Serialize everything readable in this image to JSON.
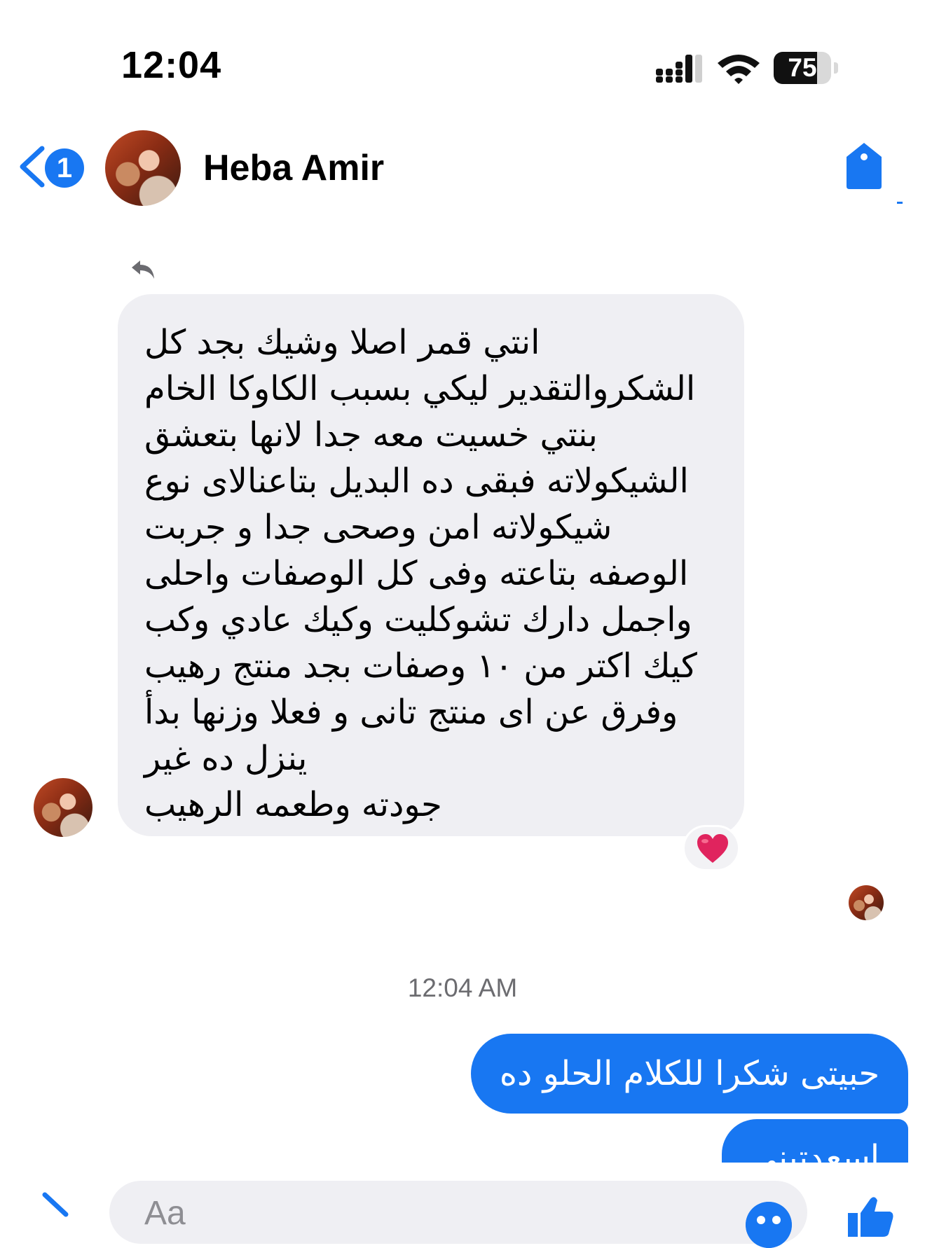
{
  "status_bar": {
    "time": "12:04",
    "battery_percent": "75",
    "battery_level": 0.75,
    "icons": [
      "signal-icon",
      "wifi-icon",
      "battery-icon"
    ]
  },
  "header": {
    "back_badge_count": "1",
    "contact_name": "Heba Amir",
    "icons": [
      "back-chevron-icon",
      "tag-icon"
    ]
  },
  "incoming_message": {
    "lines": [
      "انتي قمر اصلا وشيك بجد كل",
      "الشكروالتقدير  ليكي بسبب الكاوكا الخام",
      "بنتي خسيت معه جدا لانها بتعشق",
      "الشيكولاته فبقى ده البديل  بتاعنالاى نوع",
      "شيكولاته امن وصحى جدا و جربت",
      "الوصفه بتاعته وفى كل الوصفات واحلى",
      "واجمل دارك تشوكليت وكيك عادي وكب",
      "كيك  اكتر من ١٠ وصفات بجد منتج رهيب",
      "وفرق عن اى منتج تانى و فعلا وزنها  بدأ",
      "ينزل ده غير",
      "جودته وطعمه الرهيب"
    ],
    "reaction": "heart",
    "reaction_color": "#e0245e"
  },
  "timestamp": "12:04 AM",
  "outgoing_messages": [
    "حبيتى شكرا للكلام الحلو ده",
    "اسعدتيني"
  ],
  "composer": {
    "placeholder": "Aa",
    "icons": [
      "expand-chevron-icon",
      "emoji-icon",
      "like-icon"
    ]
  },
  "colors": {
    "accent": "#1877f2",
    "incoming_bubble": "#efeff3",
    "timestamp_text": "#6c6c70"
  }
}
